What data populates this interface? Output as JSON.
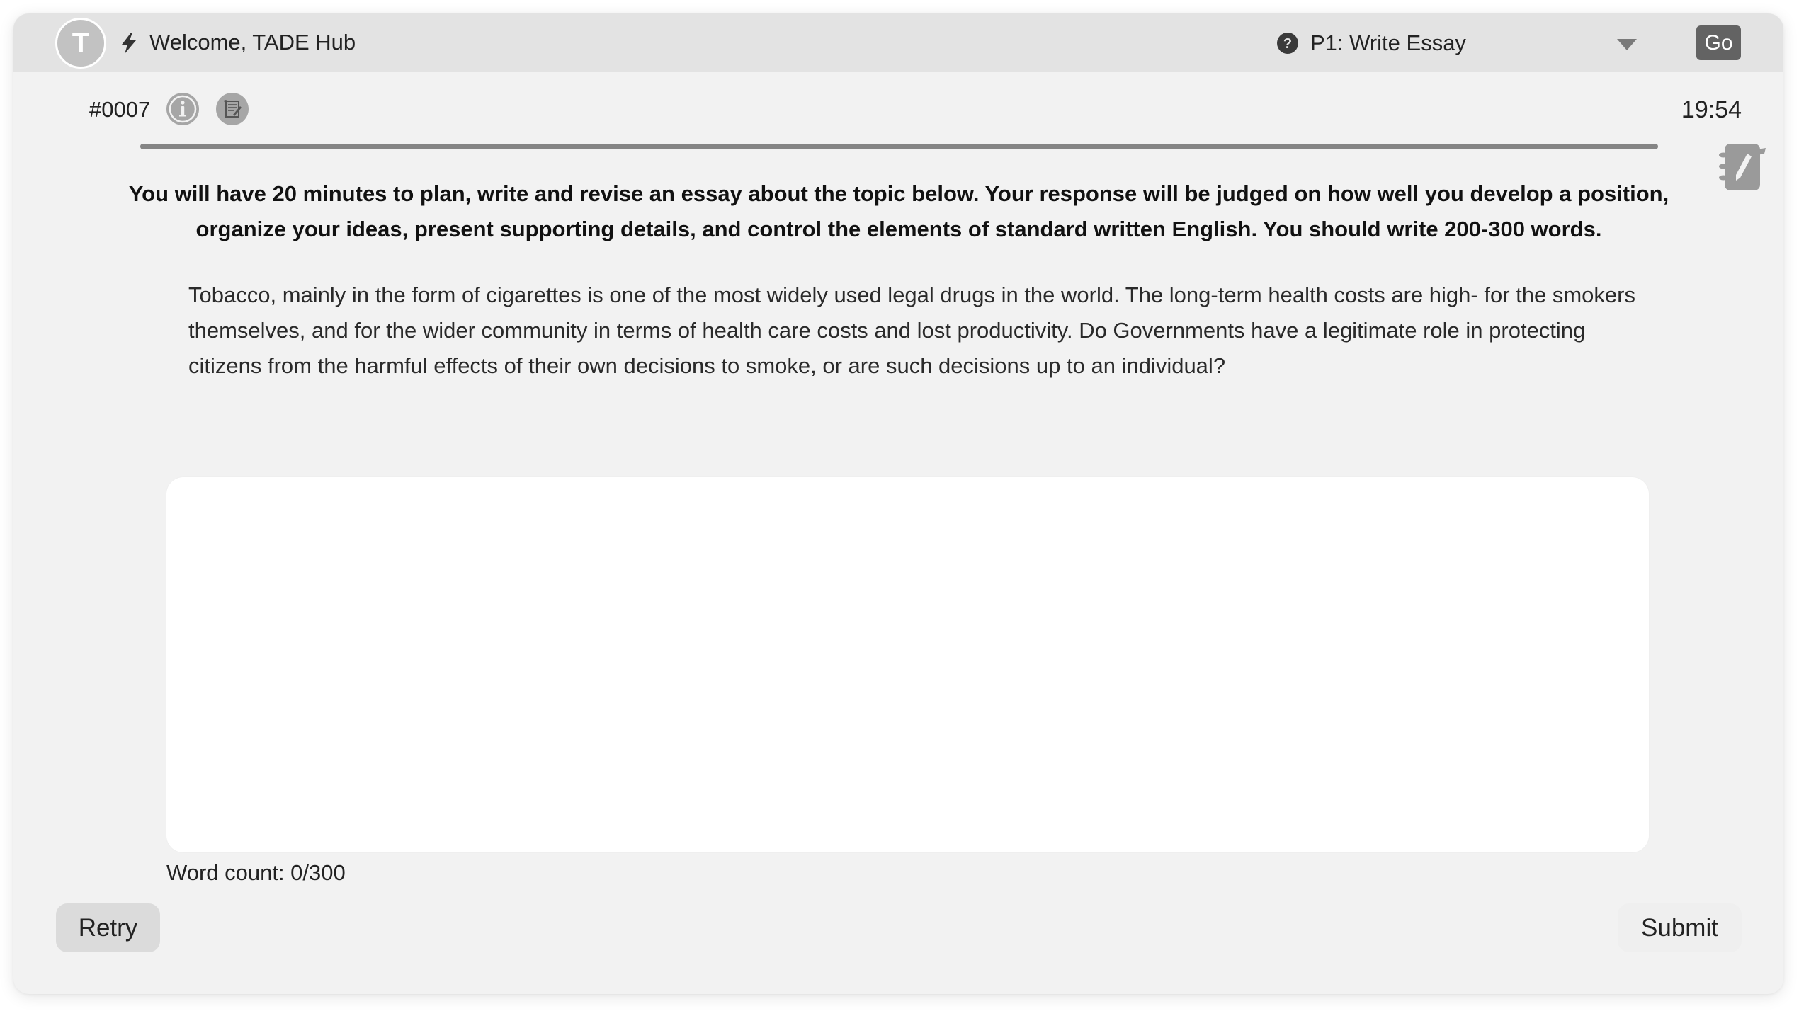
{
  "header": {
    "avatar_initial": "T",
    "welcome_text": "Welcome, TADE Hub",
    "task_select": {
      "selected": "P1: Write Essay"
    },
    "go_label": "Go"
  },
  "question": {
    "id": "#0007",
    "timer": "19:54",
    "progress_percent": 100
  },
  "instructions": "You will have 20 minutes to plan, write and revise an essay about the topic below. Your response will be judged on how well you develop a position, organize your ideas, present supporting details, and control the elements of standard written English. You should write 200-300 words.",
  "prompt": "Tobacco, mainly in the form of cigarettes is one of the most widely used legal drugs in the world. The long-term health costs are high- for the smokers themselves, and for the wider community in terms of health care costs and lost productivity. Do Governments have a legitimate role in protecting citizens from the harmful effects of their own decisions to smoke, or are such decisions up to an individual?",
  "essay": {
    "value": "",
    "placeholder": ""
  },
  "word_count": "Word count: 0/300",
  "footer": {
    "retry_label": "Retry",
    "submit_label": "Submit"
  },
  "colors": {
    "header_bg": "#e3e3e3",
    "card_bg": "#f2f2f2",
    "go_bg": "#636363",
    "progress": "#858585"
  }
}
